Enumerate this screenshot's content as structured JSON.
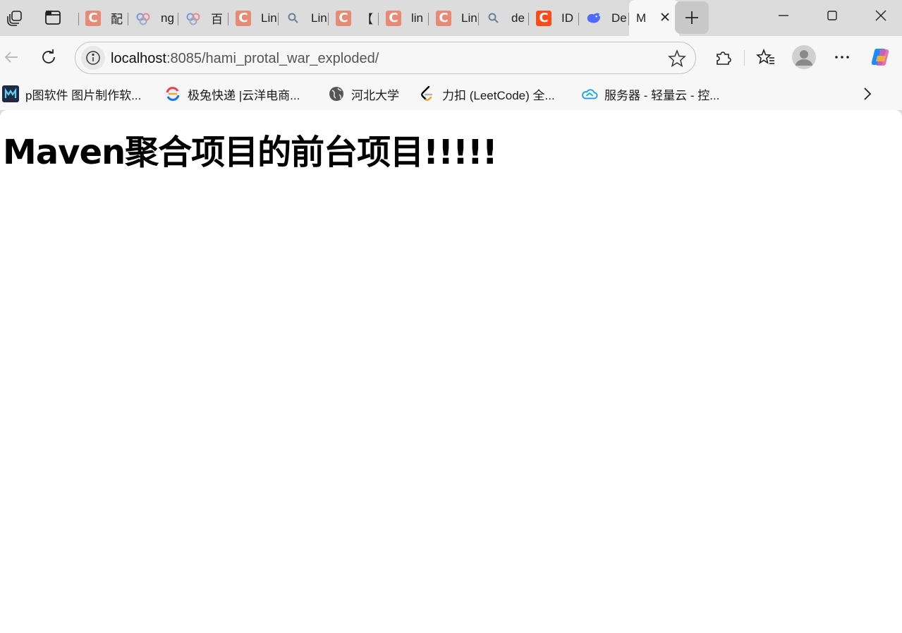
{
  "browser": {
    "tabs": [
      {
        "title": "配",
        "icon": "csdn-icon"
      },
      {
        "title": "ng",
        "icon": "baidu-paw-icon"
      },
      {
        "title": "百",
        "icon": "baidu-paw-icon"
      },
      {
        "title": "Lin",
        "icon": "csdn-icon"
      },
      {
        "title": "Lin",
        "icon": "search-icon"
      },
      {
        "title": "【",
        "icon": "csdn-icon"
      },
      {
        "title": "lin",
        "icon": "csdn-icon"
      },
      {
        "title": "Lin",
        "icon": "csdn-icon"
      },
      {
        "title": "de",
        "icon": "search-icon"
      },
      {
        "title": "ID",
        "icon": "csdn-icon"
      },
      {
        "title": "De",
        "icon": "deepseek-icon"
      },
      {
        "title": "M",
        "icon": "none",
        "active": true
      }
    ],
    "favicon_letter": "C",
    "address": {
      "host": "localhost",
      "path": ":8085/hami_protal_war_exploded/"
    },
    "bookmarks": [
      {
        "label": "p图软件 图片制作软...",
        "icon": "photo-app-icon"
      },
      {
        "label": "极兔快递 |云洋电商...",
        "icon": "jitu-express-icon"
      },
      {
        "label": "河北大学",
        "icon": "globe-icon"
      },
      {
        "label": "力扣 (LeetCode) 全...",
        "icon": "leetcode-icon"
      },
      {
        "label": "服务器 - 轻量云 - 控...",
        "icon": "cloud-icon"
      }
    ],
    "colors": {
      "chrome_bg": "#dcdcdc",
      "toolbar_bg": "#f7f7f7",
      "csdn_red": "#fc4c1c"
    }
  },
  "page": {
    "heading": "Maven聚合项目的前台项目!!!!!"
  }
}
